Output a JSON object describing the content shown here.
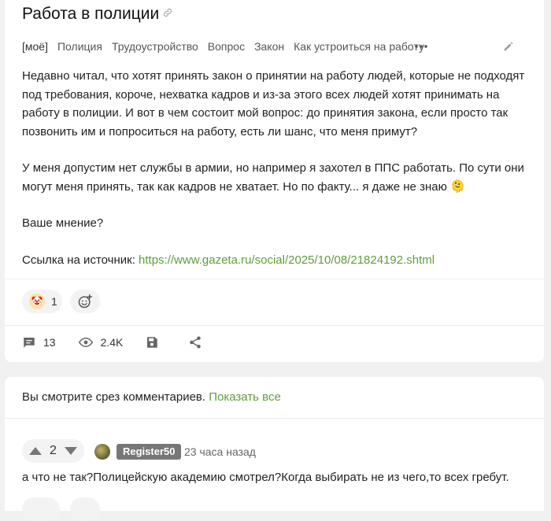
{
  "post": {
    "title": "Работа в полиции",
    "tags": [
      "[моё]",
      "Полиция",
      "Трудоустройство",
      "Вопрос",
      "Закон",
      "Как устроиться на работу"
    ],
    "paragraphs": [
      "Недавно читал, что хотят принять закон о принятии на работу людей, которые не подходят под требования, короче, нехватка кадров и из-за этого всех людей хотят принимать на работу в полиции. И вот в чем состоит мой вопрос: до принятия закона, если просто так позвонить им и попроситься на работу, есть ли шанс, что меня примут?",
      "У меня допустим нет службы в армии, но например я захотел в ППС работать. По сути они могут меня принять, так как кадров не хватает. Но по факту... я даже не знаю 🫠",
      "Ваше мнение?"
    ],
    "source_label": "Ссылка на источник: ",
    "source_url": "https://www.gazeta.ru/social/2025/10/08/21824192.shtml",
    "reaction": {
      "emoji": "🤡",
      "count": "1"
    },
    "stats": {
      "comments": "13",
      "views": "2.4K"
    }
  },
  "comments": {
    "slice_notice": "Вы смотрите срез комментариев.",
    "show_all": "Показать все",
    "first": {
      "score": "2",
      "author": "Register50",
      "time": "23 часа назад",
      "text": "а что не так?Полицейскую академию смотрел?Когда выбирать не из чего,то всех гребут."
    }
  },
  "icons": [
    "link-icon",
    "more-icon",
    "edit-icon",
    "add-reaction-icon",
    "comments-icon",
    "views-icon",
    "save-icon",
    "share-icon",
    "upvote-icon",
    "downvote-icon"
  ],
  "colors": {
    "link": "#5e9e3b",
    "background": "#f1f1f1",
    "badge": "#777777"
  }
}
